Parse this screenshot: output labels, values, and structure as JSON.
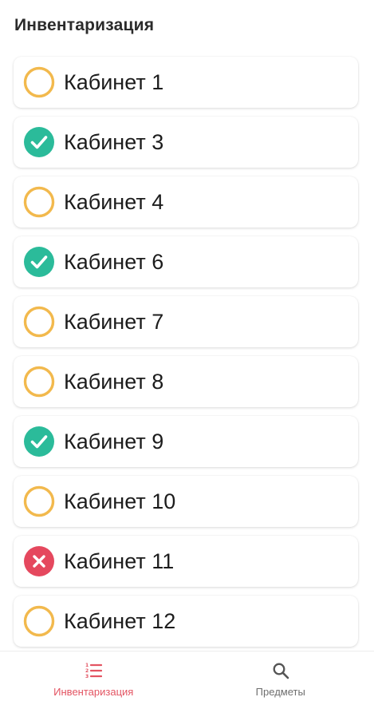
{
  "header": {
    "title": "Инвентаризация"
  },
  "colors": {
    "pending": "#F2B94D",
    "done": "#2BBB9A",
    "failed": "#E5485E",
    "nav_active": "#E35462",
    "nav_inactive": "#6E6E6E"
  },
  "rooms": [
    {
      "label": "Кабинет 1",
      "status": "pending"
    },
    {
      "label": "Кабинет 3",
      "status": "done"
    },
    {
      "label": "Кабинет 4",
      "status": "pending"
    },
    {
      "label": "Кабинет 6",
      "status": "done"
    },
    {
      "label": "Кабинет 7",
      "status": "pending"
    },
    {
      "label": "Кабинет 8",
      "status": "pending"
    },
    {
      "label": "Кабинет 9",
      "status": "done"
    },
    {
      "label": "Кабинет 10",
      "status": "pending"
    },
    {
      "label": "Кабинет 11",
      "status": "failed"
    },
    {
      "label": "Кабинет 12",
      "status": "pending"
    }
  ],
  "nav": {
    "items": [
      {
        "label": "Инвентаризация",
        "icon": "numbered-list-icon",
        "active": true
      },
      {
        "label": "Предметы",
        "icon": "search-icon",
        "active": false
      }
    ]
  }
}
